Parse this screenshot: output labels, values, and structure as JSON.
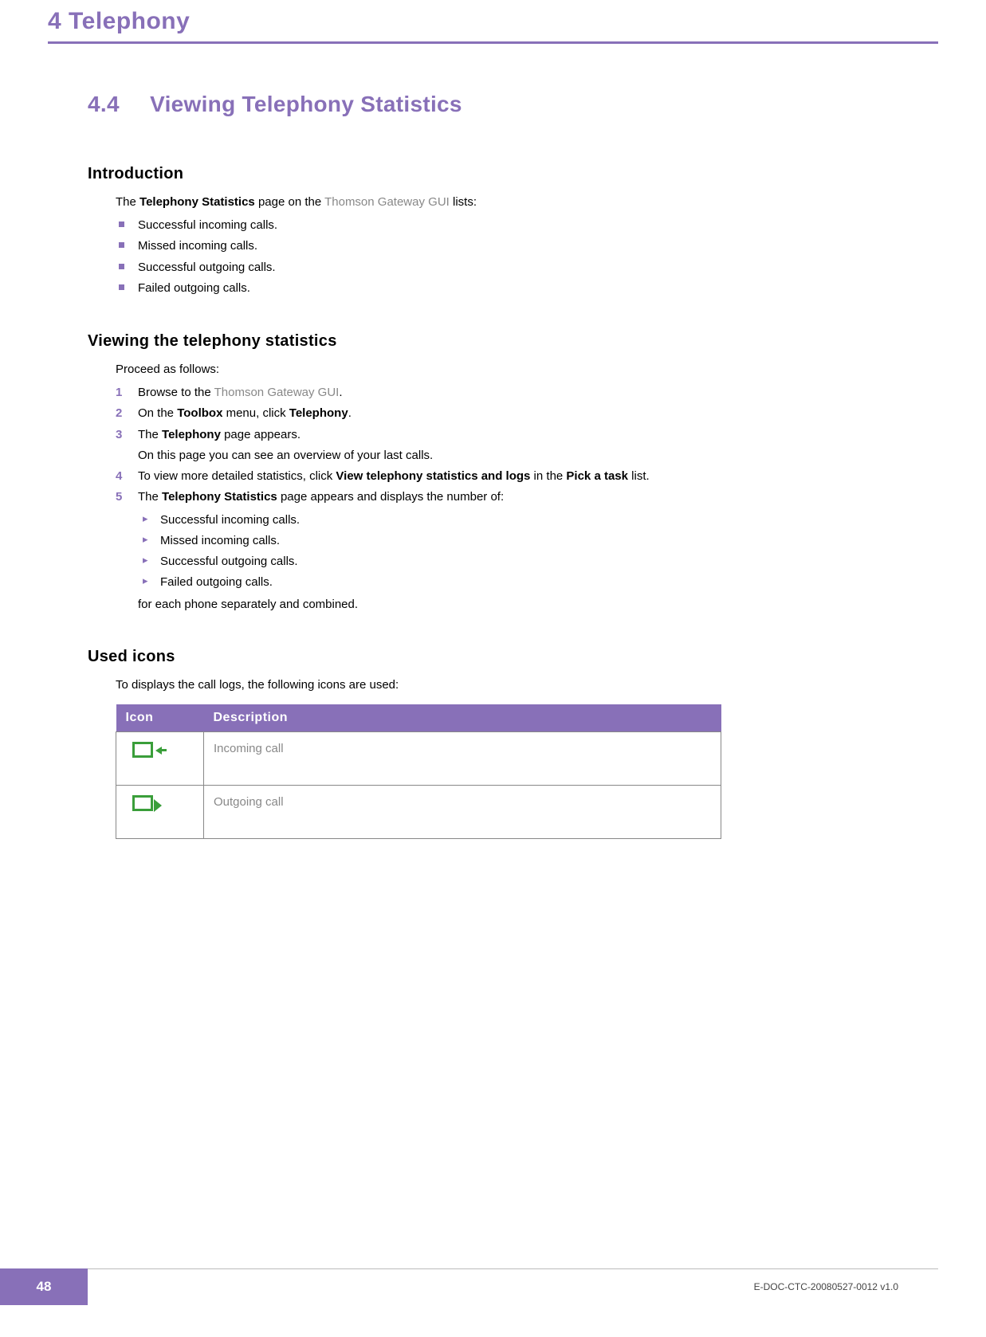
{
  "header": {
    "chapter_number": "4",
    "chapter_title": "Telephony"
  },
  "section": {
    "number": "4.4",
    "title": "Viewing Telephony Statistics"
  },
  "introduction": {
    "heading": "Introduction",
    "lead_pre": "The ",
    "lead_bold": "Telephony Statistics",
    "lead_mid": " page on the ",
    "lead_link": "Thomson Gateway GUI",
    "lead_post": " lists:",
    "bullets": [
      "Successful incoming calls.",
      "Missed incoming calls.",
      "Successful outgoing calls.",
      "Failed outgoing calls."
    ]
  },
  "viewing": {
    "heading": "Viewing the telephony statistics",
    "lead": "Proceed as follows:",
    "step1_pre": "Browse to the ",
    "step1_link": "Thomson Gateway GUI",
    "step1_post": ".",
    "step2_pre": "On the ",
    "step2_b1": "Toolbox",
    "step2_mid": " menu, click ",
    "step2_b2": "Telephony",
    "step2_post": ".",
    "step3_pre": "The ",
    "step3_b": "Telephony",
    "step3_post": " page appears.",
    "step3_line2": "On this page you can see an overview of your last calls.",
    "step4_pre": "To view more detailed statistics, click ",
    "step4_b1": "View telephony statistics and logs",
    "step4_mid": " in the ",
    "step4_b2": "Pick a task",
    "step4_post": " list.",
    "step5_pre": "The ",
    "step5_b": "Telephony Statistics",
    "step5_post": " page appears and displays the number of:",
    "step5_bullets": [
      "Successful incoming calls.",
      "Missed incoming calls.",
      "Successful outgoing calls.",
      "Failed outgoing calls."
    ],
    "step5_tail": "for each phone separately and combined."
  },
  "icons": {
    "heading": "Used icons",
    "lead": "To displays the call logs, the following icons are used:",
    "table": {
      "col1": "Icon",
      "col2": "Description",
      "rows": [
        {
          "icon": "incoming-call-icon",
          "desc": "Incoming call"
        },
        {
          "icon": "outgoing-call-icon",
          "desc": "Outgoing call"
        }
      ]
    }
  },
  "footer": {
    "page_number": "48",
    "doc_id": "E-DOC-CTC-20080527-0012 v1.0"
  }
}
